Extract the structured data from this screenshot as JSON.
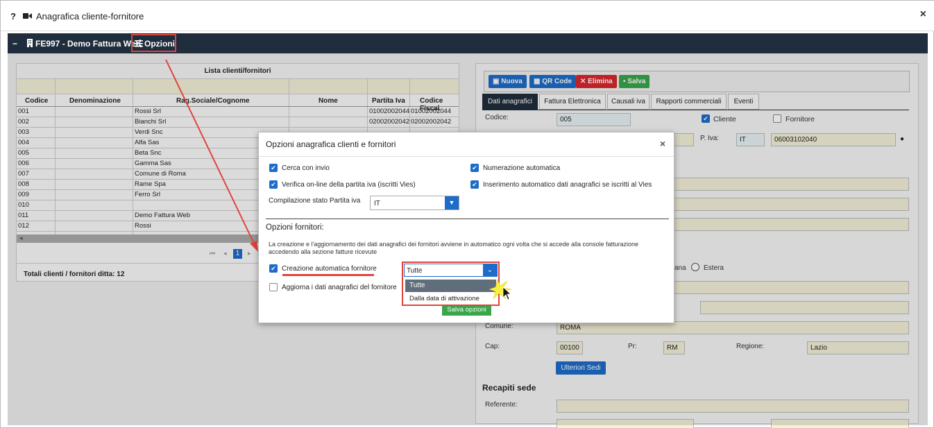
{
  "titlebar": {
    "help": "?",
    "title": "Anagrafica cliente-fornitore",
    "close": "×"
  },
  "darkbar": {
    "minus": "−",
    "company": "FE997 - Demo Fattura Web",
    "options": "Opzioni"
  },
  "list": {
    "title": "Lista clienti/fornitori",
    "columns": [
      "Codice",
      "Denominazione",
      "Rag.Sociale/Cognome",
      "Nome",
      "Partita Iva",
      "Codice Fiscal"
    ],
    "rows": [
      {
        "code": "001",
        "rag": "Rossi Srl",
        "piva": "01002002044",
        "cf": "01002002044"
      },
      {
        "code": "002",
        "rag": "Bianchi Srl",
        "piva": "02002002042",
        "cf": "02002002042"
      },
      {
        "code": "003",
        "rag": "Verdi Snc",
        "piva": "",
        "cf": ""
      },
      {
        "code": "004",
        "rag": "Alfa Sas",
        "piva": "",
        "cf": ""
      },
      {
        "code": "005",
        "rag": "Beta Snc",
        "piva": "",
        "cf": ""
      },
      {
        "code": "006",
        "rag": "Gamma Sas",
        "piva": "",
        "cf": ""
      },
      {
        "code": "007",
        "rag": "Comune di Roma",
        "piva": "",
        "cf": ""
      },
      {
        "code": "008",
        "rag": "Rame Spa",
        "piva": "",
        "cf": ""
      },
      {
        "code": "009",
        "rag": "Ferro Srl",
        "piva": "",
        "cf": ""
      },
      {
        "code": "010",
        "rag": "",
        "piva": "",
        "cf": ""
      },
      {
        "code": "011",
        "rag": "Demo Fattura Web",
        "piva": "",
        "cf": ""
      },
      {
        "code": "012",
        "rag": "Rossi",
        "piva": "",
        "cf": ""
      }
    ],
    "page": "1",
    "footer": "Totali clienti / fornitori ditta: 12"
  },
  "right": {
    "buttons": {
      "nuova": "Nuova",
      "qr": "QR Code",
      "elimina": "Elimina",
      "salva": "Salva"
    },
    "tabs": [
      "Dati anagrafici",
      "Fattura Elettronica",
      "Causali iva",
      "Rapporti commerciali",
      "Eventi"
    ],
    "codice_label": "Codice:",
    "codice_value": "005",
    "cliente": "Cliente",
    "fornitore": "Fornitore",
    "piva_label": "P. Iva:",
    "piva_country": "IT",
    "piva_value": "06003102040",
    "nazione_partial": "ana",
    "estera": "Estera",
    "comune_label": "Comune:",
    "comune_value": "ROMA",
    "cap_label": "Cap:",
    "cap_value": "00100",
    "pr_label": "Pr:",
    "pr_value": "RM",
    "regione_label": "Regione:",
    "regione_value": "Lazio",
    "ulteriori": "Ulteriori Sedi",
    "recapiti": "Recapiti sede",
    "referente_label": "Referente:"
  },
  "modal": {
    "title": "Opzioni anagrafica clienti e fornitori",
    "close": "×",
    "cerca": "Cerca con invio",
    "numerazione": "Numerazione automatica",
    "verifica": "Verifica on-line della partita iva (iscritti Vies)",
    "inserimento": "Inserimento automatico dati anagrafici se iscritti al Vies",
    "compilazione": "Compilazione stato Partita iva",
    "compilazione_value": "IT",
    "fornitori_title": "Opzioni fornitori:",
    "desc": "La creazione e l'aggiornamento dei dati anagrafici dei fornitori avviene in automatico ogni volta che si accede alla console fatturazione accedendo alla sezione fatture ricevute",
    "creazione": "Creazione automatica fornitore",
    "creazione_value": "Tutte",
    "options": [
      "Tutte",
      "Dalla data di attivazione"
    ],
    "aggiorna": "Aggiorna i dati anagrafici del fornitore",
    "salva": "Salva opzioni"
  },
  "colors": {
    "accent": "#1e6cc9",
    "dark": "#1f2d3d",
    "highlight": "#e0443e",
    "green": "#3aa64a"
  }
}
